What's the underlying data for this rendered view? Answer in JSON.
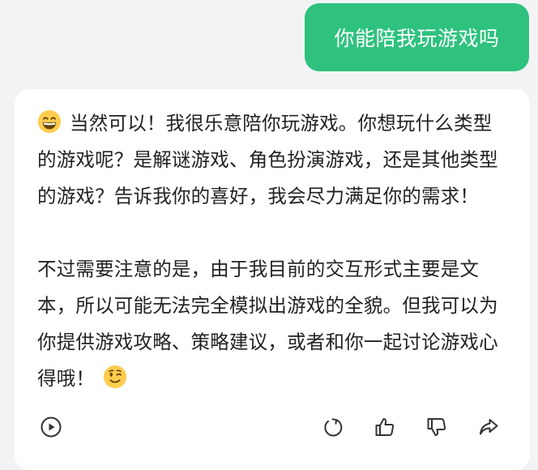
{
  "user_message": {
    "text": "你能陪我玩游戏吗"
  },
  "assistant_message": {
    "paragraph_1": "当然可以！我很乐意陪你玩游戏。你想玩什么类型的游戏呢？是解谜游戏、角色扮演游戏，还是其他类型的游戏？告诉我你的喜好，我会尽力满足你的需求！",
    "paragraph_2": "不过需要注意的是，由于我目前的交互形式主要是文本，所以可能无法完全模拟出游戏的全貌。但我可以为你提供游戏攻略、策略建议，或者和你一起讨论游戏心得哦！",
    "leading_emoji": "grinning-face-emoji",
    "trailing_emoji": "winking-face-emoji"
  },
  "actions": [
    {
      "name": "play-audio",
      "icon": "play-icon"
    },
    {
      "name": "regenerate",
      "icon": "refresh-icon"
    },
    {
      "name": "like",
      "icon": "thumbs-up-icon"
    },
    {
      "name": "dislike",
      "icon": "thumbs-down-icon"
    },
    {
      "name": "share",
      "icon": "share-icon"
    }
  ],
  "colors": {
    "user_bubble": "#2ec27e",
    "background": "#f3f3f6",
    "card": "#ffffff",
    "text": "#222222",
    "icon": "#333333"
  }
}
